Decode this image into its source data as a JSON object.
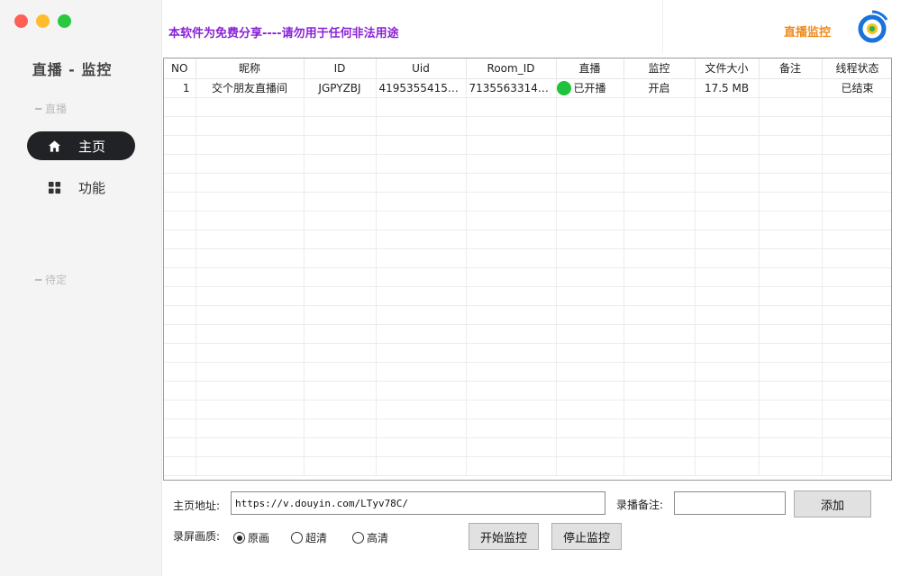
{
  "sidebar": {
    "title": "直播 - 监控",
    "section_live": "━ 直播",
    "section_pending": "━ 待定",
    "items": [
      {
        "label": "主页",
        "icon": "home-icon",
        "active": true
      },
      {
        "label": "功能",
        "icon": "grid-icon",
        "active": false
      }
    ]
  },
  "header": {
    "notice": "本软件为免费分享----请勿用于任何非法用途",
    "title": "直播监控",
    "colors": {
      "notice": "#8a23d6",
      "title": "#f08a1a"
    }
  },
  "table": {
    "columns": [
      "NO",
      "昵称",
      "ID",
      "Uid",
      "Room_ID",
      "直播",
      "监控",
      "文件大小",
      "备注",
      "线程状态"
    ],
    "rows": [
      {
        "no": "1",
        "nickname": "交个朋友直播间",
        "id": "JGPYZBJ",
        "uid": "41953554155...",
        "room_id": "71355633140...",
        "live": "已开播",
        "monitor": "开启",
        "size": "17.5 MB",
        "note": "",
        "thread_status": "已结束"
      }
    ],
    "live_dot_color": "#1ec33b"
  },
  "form": {
    "url_label": "主页地址:",
    "url_value": "https://v.douyin.com/LTyv78C/",
    "note_label": "录播备注:",
    "note_value": "",
    "add_button": "添加",
    "quality_label": "录屏画质:",
    "quality_options": [
      {
        "label": "原画",
        "checked": true
      },
      {
        "label": "超清",
        "checked": false
      },
      {
        "label": "高清",
        "checked": false
      }
    ],
    "start_button": "开始监控",
    "stop_button": "停止监控"
  }
}
